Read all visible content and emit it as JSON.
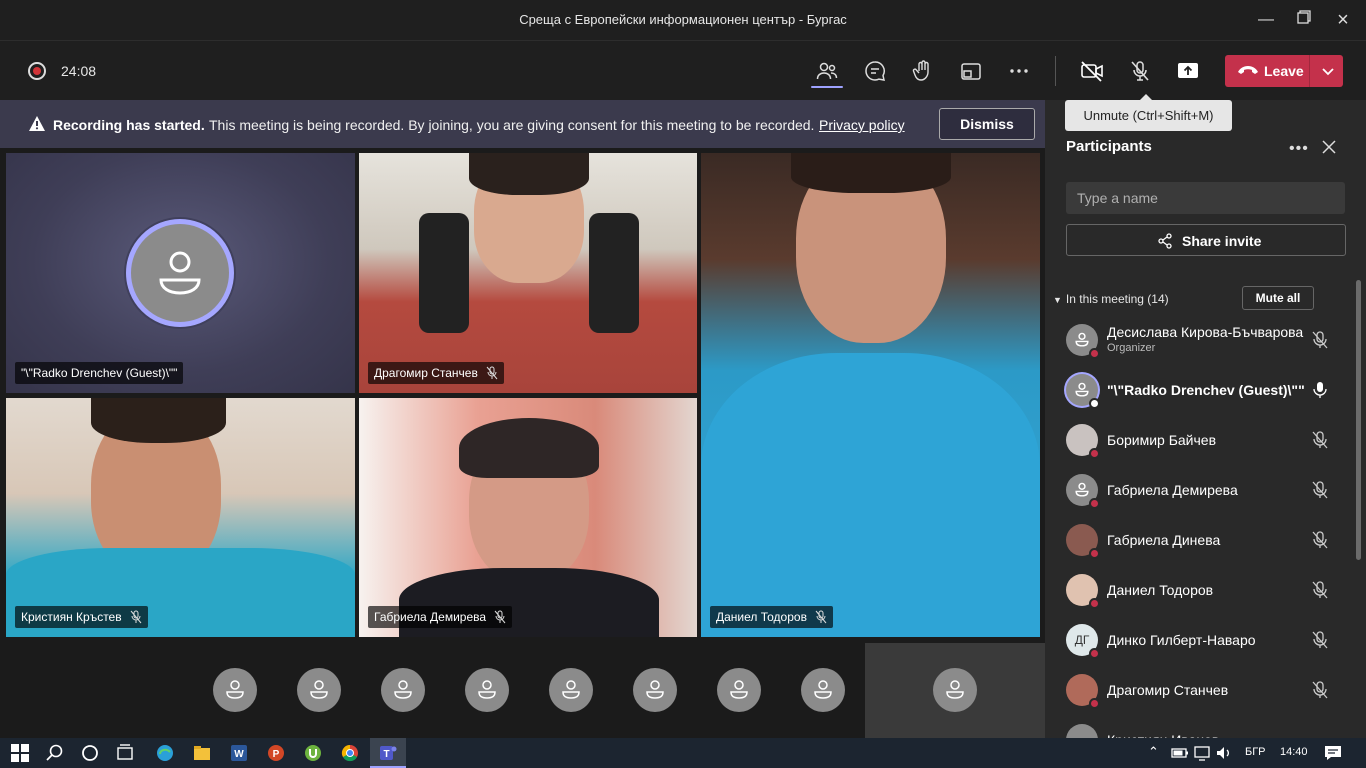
{
  "window": {
    "title": "Среща с Европейски информационен център - Бургас"
  },
  "toolbar": {
    "timer": "24:08",
    "leave_label": "Leave"
  },
  "tooltip": {
    "text": "Unmute (Ctrl+Shift+M)"
  },
  "banner": {
    "title": "Recording has started.",
    "message": "This meeting is being recorded. By joining, you are giving consent for this meeting to be recorded.",
    "link": "Privacy policy",
    "dismiss_label": "Dismiss"
  },
  "video_tiles": [
    {
      "name": "\"\\\"Radko Drenchev (Guest)\\\"\""
    },
    {
      "name": "Драгомир Станчев"
    },
    {
      "name": "Даниел Тодоров"
    },
    {
      "name": "Кристиян Кръстев"
    },
    {
      "name": "Габриела Демирева"
    }
  ],
  "participants_panel": {
    "title": "Participants",
    "search_placeholder": "Type a name",
    "share_invite_label": "Share invite",
    "in_meeting_label": "In this meeting (14)",
    "mute_all_label": "Mute all",
    "participants": [
      {
        "name": "Десислава Кирова-Бъчварова",
        "role": "Organizer",
        "initials": ""
      },
      {
        "name": "\"\\\"Radko Drenchev (Guest)\\\"\"",
        "role": "",
        "initials": ""
      },
      {
        "name": "Боримир Байчев",
        "role": "",
        "initials": ""
      },
      {
        "name": "Габриела Демирева",
        "role": "",
        "initials": ""
      },
      {
        "name": "Габриела Динева",
        "role": "",
        "initials": ""
      },
      {
        "name": "Даниел Тодоров",
        "role": "",
        "initials": ""
      },
      {
        "name": "Динко Гилберт-Наваро",
        "role": "",
        "initials": "ДГ"
      },
      {
        "name": "Драгомир Станчев",
        "role": "",
        "initials": ""
      },
      {
        "name": "Кристиян Иванов",
        "role": "",
        "initials": ""
      }
    ]
  },
  "taskbar": {
    "lang": "БГР",
    "time": "14:40"
  },
  "colors": {
    "accent": "#a5a7ff",
    "leave": "#c4314b",
    "banner": "#3b3a4d"
  }
}
